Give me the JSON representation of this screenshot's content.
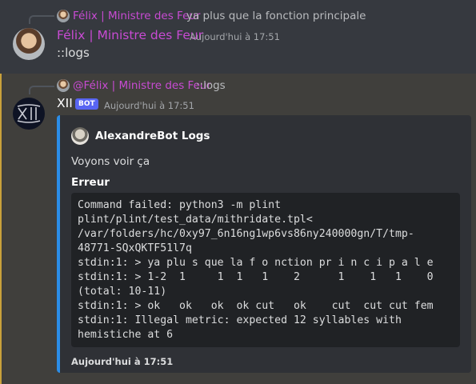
{
  "messages": [
    {
      "reply": {
        "author": "Félix | Ministre des Feur",
        "text": "ya plus que la fonction principale"
      },
      "author": "Félix | Ministre des Feur",
      "timestamp": "Aujourd'hui à 17:51",
      "content": "::logs"
    },
    {
      "reply": {
        "author": "@Félix | Ministre des Feur",
        "text": "::logs"
      },
      "author": "XII",
      "bot_tag": "BOT",
      "timestamp": "Aujourd'hui à 17:51",
      "embed": {
        "author": "AlexandreBot Logs",
        "description": "Voyons voir ça",
        "field_name": "Erreur",
        "code_lines": [
          "Command failed: python3 -m plint",
          "plint/plint/test_data/mithridate.tpl<",
          "/var/folders/hc/0xy97_6n16ng1wp6vs86ny240000gn/T/tmp-",
          "48771-SQxQKTF51l7q",
          "stdin:1: > ya plu s que la f o nction pr i n c i p a l e",
          "stdin:1: > 1-2  1     1  1   1    2      1    1   1    0",
          "(total: 10-11)",
          "stdin:1: > ok   ok   ok  ok cut   ok    cut  cut cut fem",
          "stdin:1: Illegal metric: expected 12 syllables with",
          "hemistiche at 6"
        ],
        "footer": "Aujourd'hui à 17:51",
        "accent_color": "#2b8de7"
      }
    }
  ],
  "colors": {
    "background": "#36393f",
    "highlight_background": "#403f3c",
    "mention_bar": "#c9a13b",
    "role_color": "#c84bd3",
    "bot_tag": "#5865f2"
  }
}
